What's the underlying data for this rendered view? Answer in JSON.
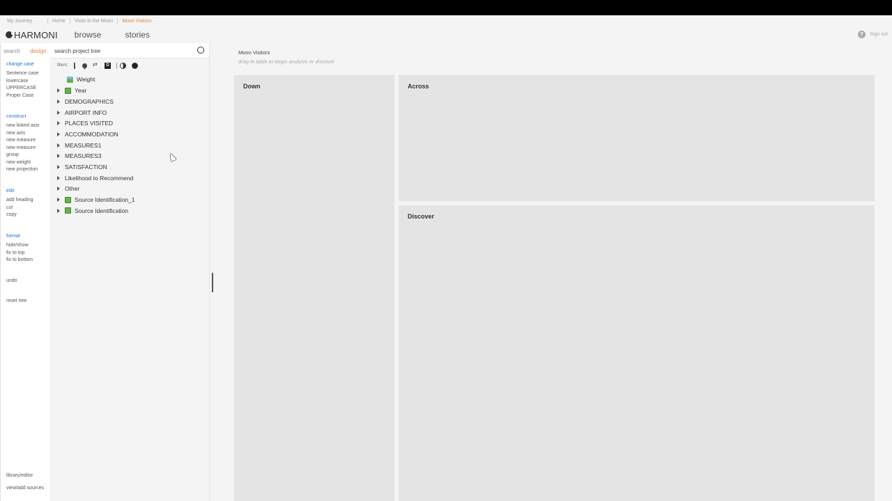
{
  "breadcrumbs": {
    "items": [
      "My Journey",
      "Home",
      "Visits to the Moon",
      "Moon Visitors"
    ],
    "active_color": "#e8823a"
  },
  "header": {
    "logo_text": "HARMONI",
    "nav_browse": "browse",
    "nav_stories": "stories",
    "help_icon": "question-circle-icon",
    "signout": "Sign out"
  },
  "sidebar": {
    "tabs": {
      "search": "search",
      "design": "design"
    },
    "change_case": {
      "heading": "change case",
      "items": [
        "Sentence case",
        "lowercase",
        "UPPERCASE",
        "Proper Case"
      ]
    },
    "construct": {
      "heading": "construct",
      "items": [
        "new linked axis",
        "new axis",
        "new measure",
        "new measure",
        "group",
        "new weight",
        "new projection"
      ]
    },
    "edit": {
      "heading": "edit",
      "items": [
        "add heading",
        "cut",
        "copy"
      ]
    },
    "format": {
      "heading": "format",
      "items": [
        "hide/show",
        "fix to top",
        "fix to bottom"
      ]
    },
    "undo": "undo",
    "reset_tree": "reset tree",
    "bottom_items": [
      "library/editor",
      "view/add sources"
    ]
  },
  "tree_panel": {
    "search_placeholder": "search project tree",
    "filters_label": "filters:",
    "filter_icons": [
      "bar-icon",
      "pin-icon",
      "swap-icon",
      "d-icon",
      "half-circle-icon",
      "full-circle-icon"
    ],
    "nodes": [
      {
        "label": "Weight",
        "icon": "weight-icon",
        "expandable": false
      },
      {
        "label": "Year",
        "icon": "year-icon",
        "expandable": true
      },
      {
        "label": "DEMOGRAPHICS",
        "expandable": true
      },
      {
        "label": "AIRPORT INFO",
        "expandable": true
      },
      {
        "label": "PLACES VISITED",
        "expandable": true
      },
      {
        "label": "ACCOMMODATION",
        "expandable": true
      },
      {
        "label": "MEASURES1",
        "expandable": true
      },
      {
        "label": "MEASURES3",
        "expandable": true
      },
      {
        "label": "SATISFACTION",
        "expandable": true
      },
      {
        "label": "Likelihood to Recommend",
        "expandable": true
      },
      {
        "label": "Other",
        "expandable": true
      },
      {
        "label": "Source Identification_1",
        "icon": "source-icon",
        "expandable": true
      },
      {
        "label": "Source Identification",
        "icon": "source-icon",
        "expandable": true
      }
    ]
  },
  "main": {
    "title": "Moon Visitors",
    "hint": "drag to table to begin analysis or discover",
    "panels": {
      "down": "Down",
      "across": "Across",
      "discover": "Discover"
    }
  }
}
